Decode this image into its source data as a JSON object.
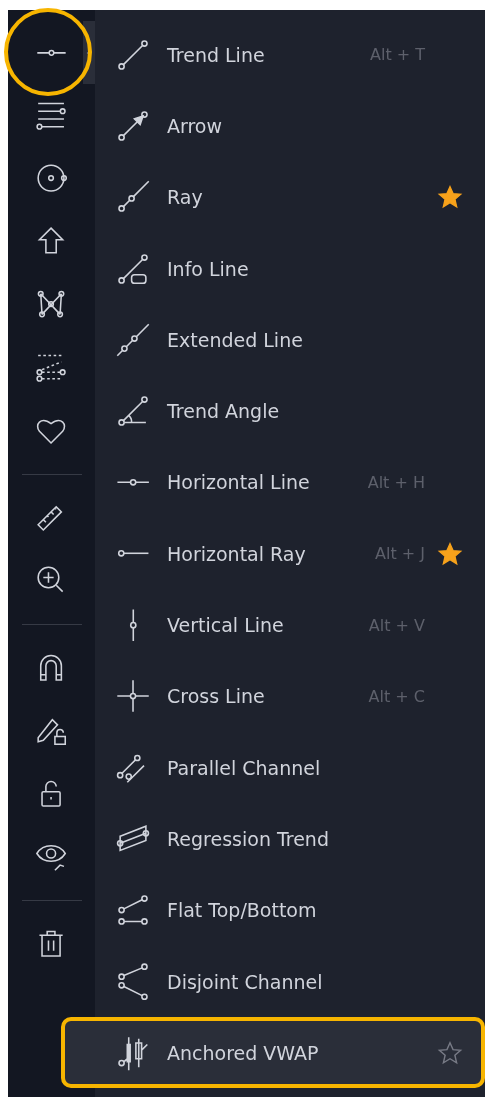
{
  "toolbar": [
    {
      "kind": "tool",
      "open": true,
      "highlighted": true
    },
    {
      "kind": "tool",
      "open": false,
      "highlighted": false
    },
    {
      "kind": "tool",
      "open": false,
      "highlighted": false
    },
    {
      "kind": "tool",
      "open": false,
      "highlighted": false
    },
    {
      "kind": "tool",
      "open": false,
      "highlighted": false
    },
    {
      "kind": "tool",
      "open": false,
      "highlighted": false
    },
    {
      "kind": "tool",
      "open": false,
      "highlighted": false
    },
    {
      "kind": "divider"
    },
    {
      "kind": "tool",
      "open": false,
      "highlighted": false
    },
    {
      "kind": "tool",
      "open": false,
      "highlighted": false
    },
    {
      "kind": "divider"
    },
    {
      "kind": "tool",
      "open": false,
      "highlighted": false
    },
    {
      "kind": "tool",
      "open": false,
      "highlighted": false
    },
    {
      "kind": "tool",
      "open": false,
      "highlighted": false
    },
    {
      "kind": "tool",
      "open": false,
      "highlighted": false
    },
    {
      "kind": "divider"
    },
    {
      "kind": "tool",
      "open": false,
      "highlighted": false
    }
  ],
  "menu": [
    {
      "label": "Trend Line",
      "shortcut": "Alt + T",
      "starred": false,
      "highlighted": false
    },
    {
      "label": "Arrow",
      "starred": false,
      "highlighted": false
    },
    {
      "label": "Ray",
      "starred": true,
      "highlighted": false
    },
    {
      "label": "Info Line",
      "starred": false,
      "highlighted": false
    },
    {
      "label": "Extended Line",
      "starred": false,
      "highlighted": false
    },
    {
      "label": "Trend Angle",
      "starred": false,
      "highlighted": false
    },
    {
      "label": "Horizontal Line",
      "shortcut": "Alt + H",
      "starred": false,
      "highlighted": false
    },
    {
      "label": "Horizontal Ray",
      "shortcut": "Alt + J",
      "starred": true,
      "highlighted": false
    },
    {
      "label": "Vertical Line",
      "shortcut": "Alt + V",
      "starred": false,
      "highlighted": false
    },
    {
      "label": "Cross Line",
      "shortcut": "Alt + C",
      "starred": false,
      "highlighted": false
    },
    {
      "label": "Parallel Channel",
      "starred": false,
      "highlighted": false
    },
    {
      "label": "Regression Trend",
      "starred": false,
      "highlighted": false
    },
    {
      "label": "Flat Top/Bottom",
      "starred": false,
      "highlighted": false
    },
    {
      "label": "Disjoint Channel",
      "starred": false,
      "highlighted": false
    },
    {
      "label": "Anchored VWAP",
      "starred": false,
      "highlighted": true
    }
  ]
}
